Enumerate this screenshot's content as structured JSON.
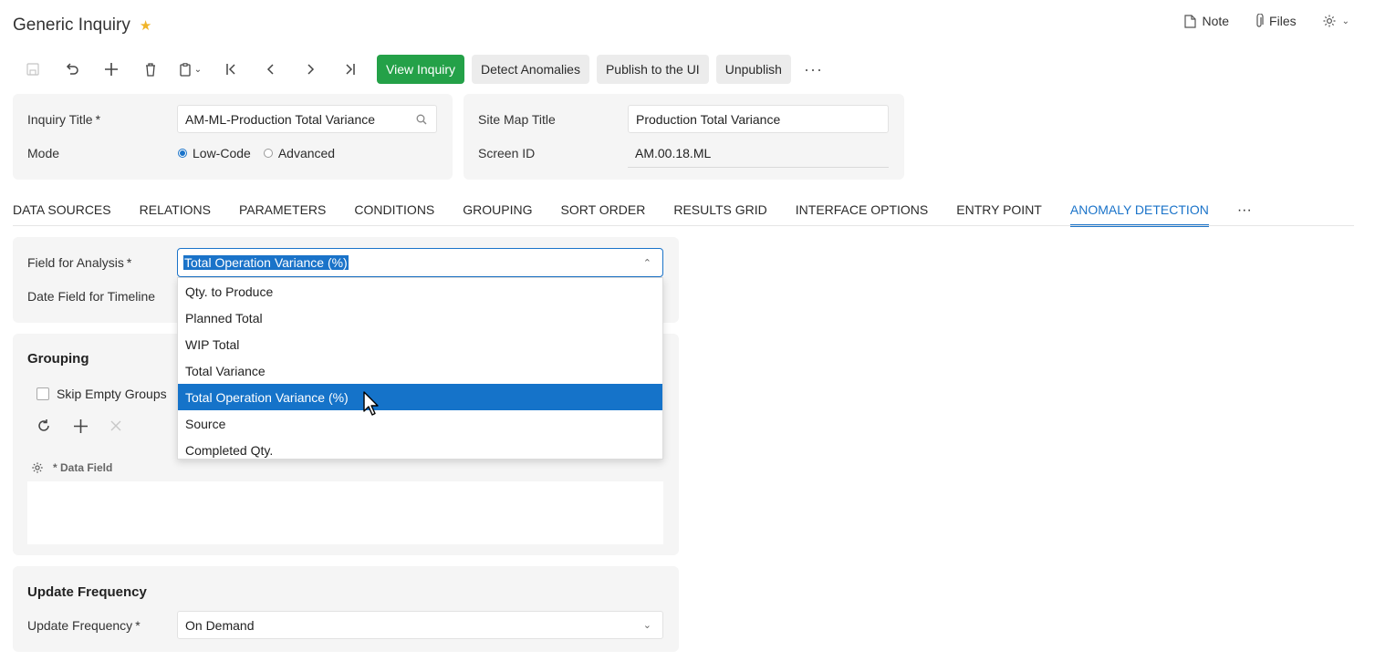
{
  "header": {
    "title": "Generic Inquiry",
    "note_label": "Note",
    "files_label": "Files"
  },
  "toolbar": {
    "view_inquiry": "View Inquiry",
    "detect_anomalies": "Detect Anomalies",
    "publish": "Publish to the UI",
    "unpublish": "Unpublish",
    "more": "···"
  },
  "summary": {
    "inquiry_title_label": "Inquiry Title",
    "inquiry_title_value": "AM-ML-Production Total Variance",
    "mode_label": "Mode",
    "mode_options": [
      "Low-Code",
      "Advanced"
    ],
    "mode_selected": "Low-Code",
    "site_map_title_label": "Site Map Title",
    "site_map_title_value": "Production Total Variance",
    "screen_id_label": "Screen ID",
    "screen_id_value": "AM.00.18.ML"
  },
  "tabs": [
    "DATA SOURCES",
    "RELATIONS",
    "PARAMETERS",
    "CONDITIONS",
    "GROUPING",
    "SORT ORDER",
    "RESULTS GRID",
    "INTERFACE OPTIONS",
    "ENTRY POINT",
    "ANOMALY DETECTION"
  ],
  "tabs_more": "···",
  "active_tab": "ANOMALY DETECTION",
  "analysis": {
    "field_label": "Field for Analysis",
    "field_value": "Total Operation Variance (%)",
    "date_field_label": "Date Field for Timeline",
    "options": [
      "Qty. to Produce",
      "Planned Total",
      "WIP Total",
      "Total Variance",
      "Total Operation Variance (%)",
      "Source",
      "Completed Qty."
    ],
    "highlighted": "Total Operation Variance (%)"
  },
  "grouping": {
    "title": "Grouping",
    "skip_empty_label": "Skip Empty Groups",
    "skip_empty_checked": false,
    "column_data_field": "* Data Field"
  },
  "update_frequency": {
    "title": "Update Frequency",
    "label": "Update Frequency",
    "value": "On Demand"
  },
  "colors": {
    "primary_green": "#24a148",
    "accent_blue": "#1a73c9",
    "star": "#f0b429"
  }
}
